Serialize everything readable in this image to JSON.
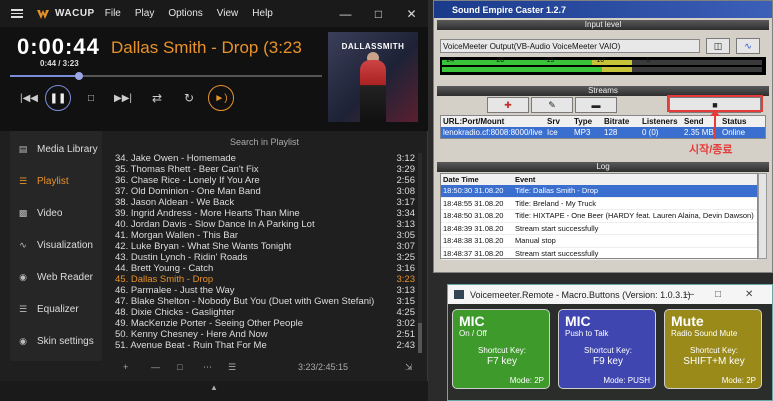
{
  "wacup": {
    "app_name": "WACUP",
    "menu": [
      "File",
      "Play",
      "Options",
      "View",
      "Help"
    ],
    "time": "0:00:44",
    "time_sub": "0:44 / 3:23",
    "now_playing": "Dallas Smith - Drop (3:23",
    "seek_fraction": 0.22,
    "album_art_text": "DALLASSMITH",
    "sidebar": [
      "Media Library",
      "Playlist",
      "Video",
      "Visualization",
      "Web Reader",
      "Equalizer",
      "Skin settings"
    ],
    "sidebar_active": 1,
    "search_placeholder": "Search in Playlist",
    "playlist": [
      {
        "title": "34. Jake Owen - Homemade",
        "dur": "3:12"
      },
      {
        "title": "35. Thomas Rhett - Beer Can't Fix",
        "dur": "3:29"
      },
      {
        "title": "36. Chase Rice - Lonely If You Are",
        "dur": "2:56"
      },
      {
        "title": "37. Old Dominion - One Man Band",
        "dur": "3:08"
      },
      {
        "title": "38. Jason Aldean - We Back",
        "dur": "3:17"
      },
      {
        "title": "39. Ingrid Andress - More Hearts Than Mine",
        "dur": "3:34"
      },
      {
        "title": "40. Jordan Davis - Slow Dance In A Parking Lot",
        "dur": "3:13"
      },
      {
        "title": "41. Morgan Wallen - This Bar",
        "dur": "3:05"
      },
      {
        "title": "42. Luke Bryan - What She Wants Tonight",
        "dur": "3:07"
      },
      {
        "title": "43. Dustin Lynch - Ridin' Roads",
        "dur": "3:25"
      },
      {
        "title": "44. Brett Young - Catch",
        "dur": "3:16"
      },
      {
        "title": "45. Dallas Smith - Drop",
        "dur": "3:23"
      },
      {
        "title": "46. Parmalee - Just the Way",
        "dur": "3:13"
      },
      {
        "title": "47. Blake Shelton - Nobody But You (Duet with Gwen Stefani)",
        "dur": "3:15"
      },
      {
        "title": "48. Dixie Chicks - Gaslighter",
        "dur": "4:25"
      },
      {
        "title": "49. MacKenzie Porter - Seeing Other People",
        "dur": "3:02"
      },
      {
        "title": "50. Kenny Chesney - Here And Now",
        "dur": "2:51"
      },
      {
        "title": "51. Avenue Beat - Ruin That For Me",
        "dur": "2:43"
      }
    ],
    "current_index": 11,
    "footer_stats": "3:23/2:45:15"
  },
  "caster": {
    "title": "Sound Empire Caster 1.2.7",
    "input_level_label": "Input level",
    "device": "VoiceMeeter Output(VB-Audio VoiceMeeter VAIO)",
    "meter_ticks": [
      "-24",
      "-20",
      "-15",
      "-10",
      "-5"
    ],
    "streams_label": "Streams",
    "stop_glyph": "■",
    "columns": [
      "URL:Port/Mount",
      "Srv",
      "Type",
      "Bitrate",
      "Listeners",
      "Send",
      "Status"
    ],
    "stream_row": [
      "lenokradio.cf:8008:8000/live",
      "Ice",
      "MP3",
      "128",
      "0 (0)",
      "2.35 MB",
      "Online"
    ],
    "annotation": "시작/종료",
    "log_label": "Log",
    "log_columns": [
      "Date Time",
      "Event"
    ],
    "log": [
      {
        "dt": "18:50:30 31.08.20",
        "ev": "Title: Dallas Smith - Drop"
      },
      {
        "dt": "18:48:55 31.08.20",
        "ev": "Title: Breland - My Truck"
      },
      {
        "dt": "18:48:50 31.08.20",
        "ev": "Title: HIXTAPE - One Beer (HARDY feat. Lauren Alaina, Devin Dawson)"
      },
      {
        "dt": "18:48:39 31.08.20",
        "ev": "Stream start successfully"
      },
      {
        "dt": "18:48:38 31.08.20",
        "ev": "Manual stop"
      },
      {
        "dt": "18:48:37 31.08.20",
        "ev": "Stream start successfully"
      }
    ]
  },
  "remote": {
    "title": "Voicemeeter.Remote - Macro.Buttons (Version: 1.0.3.1)",
    "buttons": [
      {
        "name": "MIC",
        "sub": "On / Off",
        "shortcut_label": "Shortcut Key:",
        "key": "F7 key",
        "mode": "Mode: 2P",
        "color": "#3f9a2c"
      },
      {
        "name": "MIC",
        "sub": "Push to Talk",
        "shortcut_label": "Shortcut Key:",
        "key": "F9 key",
        "mode": "Mode: PUSH",
        "color": "#3f46b0"
      },
      {
        "name": "Mute",
        "sub": "Radio Sound Mute",
        "shortcut_label": "Shortcut Key:",
        "key": "SHIFT+M key",
        "mode": "Mode: 2P",
        "color": "#9a8a1a"
      }
    ]
  }
}
